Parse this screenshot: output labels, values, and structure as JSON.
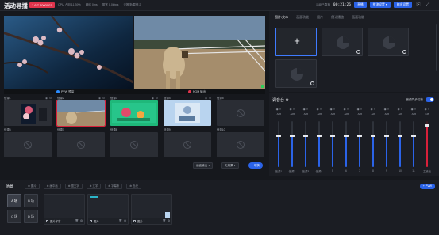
{
  "header": {
    "title": "活动导播",
    "live_badge": "1.6.7 2000007",
    "stats": [
      "CPU 占用 11.39%",
      "网络 0ms",
      "带宽 0.0kbps",
      "无推流/暂停 2"
    ],
    "elapsed_label": "活动已直播",
    "elapsed_time": "00:21:26",
    "buttons": {
      "start": "直播",
      "settings": "推流设置 ▾",
      "output": "输出设置"
    }
  },
  "monitor": {
    "pvw_label": "PVW 预监",
    "pgm_label": "PGM 输出",
    "pvw_color": "#2b8cff",
    "pgm_color": "#e1344c"
  },
  "sources": [
    {
      "label": "信源1",
      "state": "filled"
    },
    {
      "label": "信源2",
      "state": "selected"
    },
    {
      "label": "信源3",
      "state": "filled"
    },
    {
      "label": "信源4",
      "state": "filled"
    },
    {
      "label": "信源5",
      "state": "empty"
    },
    {
      "label": "信源6",
      "state": "empty"
    },
    {
      "label": "信源7",
      "state": "empty"
    },
    {
      "label": "信源8",
      "state": "empty"
    },
    {
      "label": "信源9",
      "state": "empty"
    },
    {
      "label": "信源10",
      "state": "empty"
    }
  ],
  "source_controls": {
    "layout": "画面输出",
    "transition": "无效果",
    "apply": "+ 切换"
  },
  "right_panel": {
    "tabs": [
      "图片/文本",
      "画面功能",
      "图片",
      "倒计播放",
      "画面功能"
    ],
    "active_tab": 0
  },
  "mixer": {
    "title": "调音台",
    "sync_label": "音频同步切换",
    "channels": [
      {
        "value": "-6dB",
        "level": 0.68,
        "foot": "信源1"
      },
      {
        "value": "-6dB",
        "level": 0.68,
        "foot": "信源2"
      },
      {
        "value": "-6dB",
        "level": 0.68,
        "foot": "信源3"
      },
      {
        "value": "-6dB",
        "level": 0.68,
        "foot": "信源4"
      },
      {
        "value": "-6dB",
        "level": 0.68,
        "foot": "5"
      },
      {
        "value": "-6dB",
        "level": 0.68,
        "foot": "6"
      },
      {
        "value": "-6dB",
        "level": 0.68,
        "foot": "7"
      },
      {
        "value": "-6dB",
        "level": 0.68,
        "foot": "8"
      },
      {
        "value": "-6dB",
        "level": 0.68,
        "foot": "9"
      },
      {
        "value": "-6dB",
        "level": 0.68,
        "foot": "10"
      },
      {
        "value": "-6dB",
        "level": 0.68,
        "foot": "11"
      },
      {
        "value": "0dB",
        "level": 0.9,
        "foot": "主输出"
      }
    ]
  },
  "scenes": {
    "title": "场景",
    "chips": [
      "图片",
      "画中画",
      "图文字",
      "文字",
      "字幕条",
      "色块"
    ],
    "pvw_button": "+ PVW",
    "scene_buttons": [
      "A 场",
      "B 场",
      "C 场",
      "D 场"
    ],
    "layers": [
      {
        "label": "图片字幕"
      },
      {
        "label": "图片"
      },
      {
        "label": "图片"
      }
    ]
  }
}
